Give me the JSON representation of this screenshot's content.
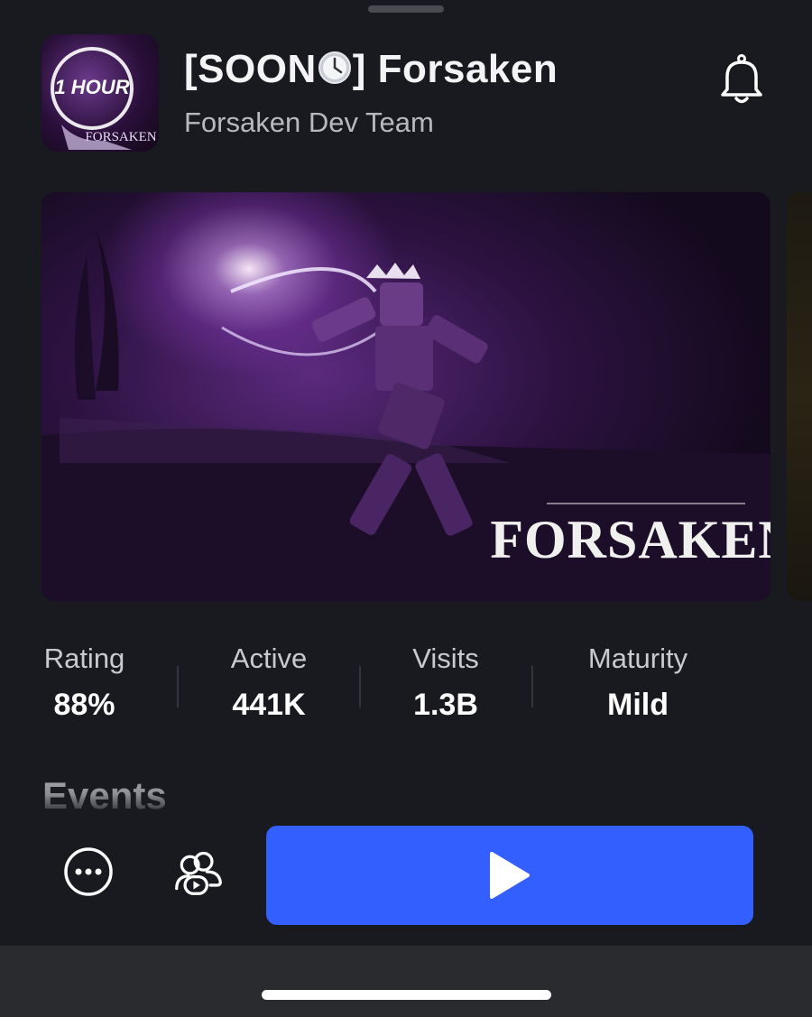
{
  "header": {
    "title_prefix": "[SOON",
    "title_suffix": "] Forsaken",
    "title_emoji_icon": "clock-emoji-icon",
    "creator": "Forsaken Dev Team",
    "bell_icon": "bell-icon"
  },
  "game_icon": {
    "text_line1": "1 HOUR",
    "text_line2": "FORSAKEN"
  },
  "media": {
    "logo_text": "FORSAKEN"
  },
  "stats": [
    {
      "label": "Rating",
      "value": "88%"
    },
    {
      "label": "Active",
      "value": "441K"
    },
    {
      "label": "Visits",
      "value": "1.3B"
    },
    {
      "label": "Maturity",
      "value": "Mild"
    }
  ],
  "sections": {
    "events_heading": "Events"
  },
  "actions": {
    "more_icon": "more-options-icon",
    "friends_icon": "play-with-friends-icon",
    "play_icon": "play-triangle-icon"
  },
  "colors": {
    "background": "#191a1f",
    "play_button": "#335fff",
    "secondary_text": "#b8b9bf",
    "bottom_bar": "#2a2b2f"
  }
}
